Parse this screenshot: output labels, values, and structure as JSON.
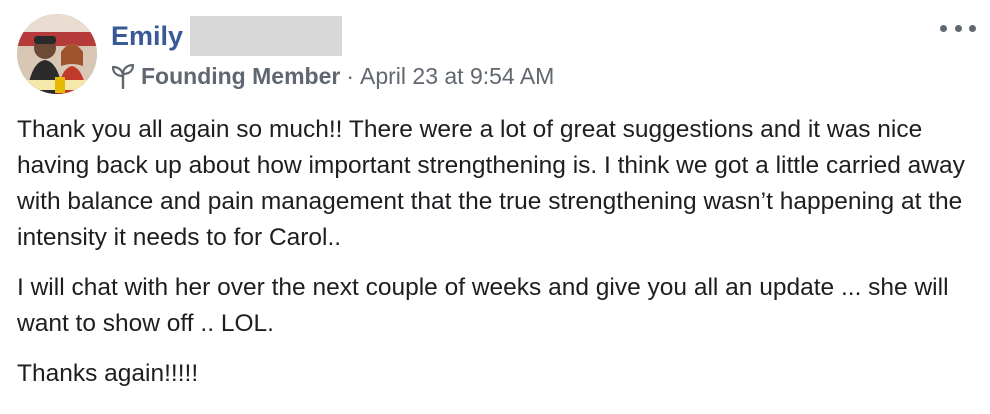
{
  "author": {
    "name": "Emily"
  },
  "meta": {
    "badge_icon": "sprout-icon",
    "badge": "Founding Member",
    "separator": "·",
    "timestamp": "April 23 at 9:54 AM"
  },
  "menu": {
    "icon": "more-horizontal-icon"
  },
  "post": {
    "paragraphs": [
      "Thank you all again so much!! There were a lot of great suggestions and it was nice having back up about how important strengthening is. I think we got a little carried away with balance and pain management that the true strengthening wasn’t happening at the intensity it needs to for Carol..",
      "I will chat with her over the next couple of weeks and give you all an update ... she will want to show off .. LOL.",
      "Thanks again!!!!!"
    ]
  },
  "colors": {
    "name_link": "#385898",
    "meta_text": "#606770",
    "body_text": "#1c1e21"
  }
}
